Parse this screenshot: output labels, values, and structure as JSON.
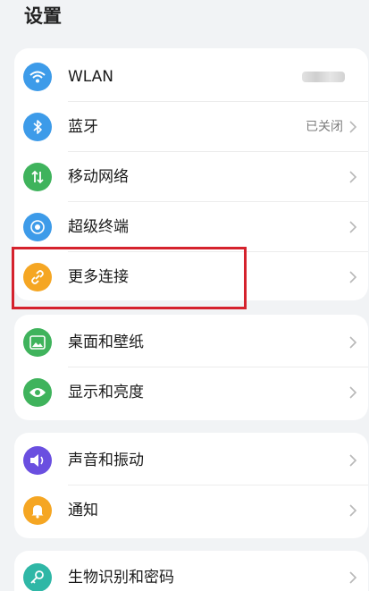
{
  "header": {
    "title": "设置"
  },
  "groups": [
    {
      "items": [
        {
          "label": "WLAN",
          "value": "",
          "icon": "wifi-icon",
          "color": "#3d9be9"
        },
        {
          "label": "蓝牙",
          "value": "已关闭",
          "icon": "bluetooth-icon",
          "color": "#3d9be9"
        },
        {
          "label": "移动网络",
          "value": "",
          "icon": "mobile-network-icon",
          "color": "#3fb35c"
        },
        {
          "label": "超级终端",
          "value": "",
          "icon": "super-device-icon",
          "color": "#3d9be9"
        },
        {
          "label": "更多连接",
          "value": "",
          "icon": "link-icon",
          "color": "#f5a623"
        }
      ]
    },
    {
      "items": [
        {
          "label": "桌面和壁纸",
          "value": "",
          "icon": "wallpaper-icon",
          "color": "#3fb35c"
        },
        {
          "label": "显示和亮度",
          "value": "",
          "icon": "eye-icon",
          "color": "#3fb35c"
        }
      ]
    },
    {
      "items": [
        {
          "label": "声音和振动",
          "value": "",
          "icon": "speaker-icon",
          "color": "#6a4fe0"
        },
        {
          "label": "通知",
          "value": "",
          "icon": "bell-icon",
          "color": "#f5a623"
        }
      ]
    },
    {
      "items": [
        {
          "label": "生物识别和密码",
          "value": "",
          "icon": "key-icon",
          "color": "#2fb7a6"
        }
      ]
    }
  ],
  "highlight_color": "#d5222d"
}
